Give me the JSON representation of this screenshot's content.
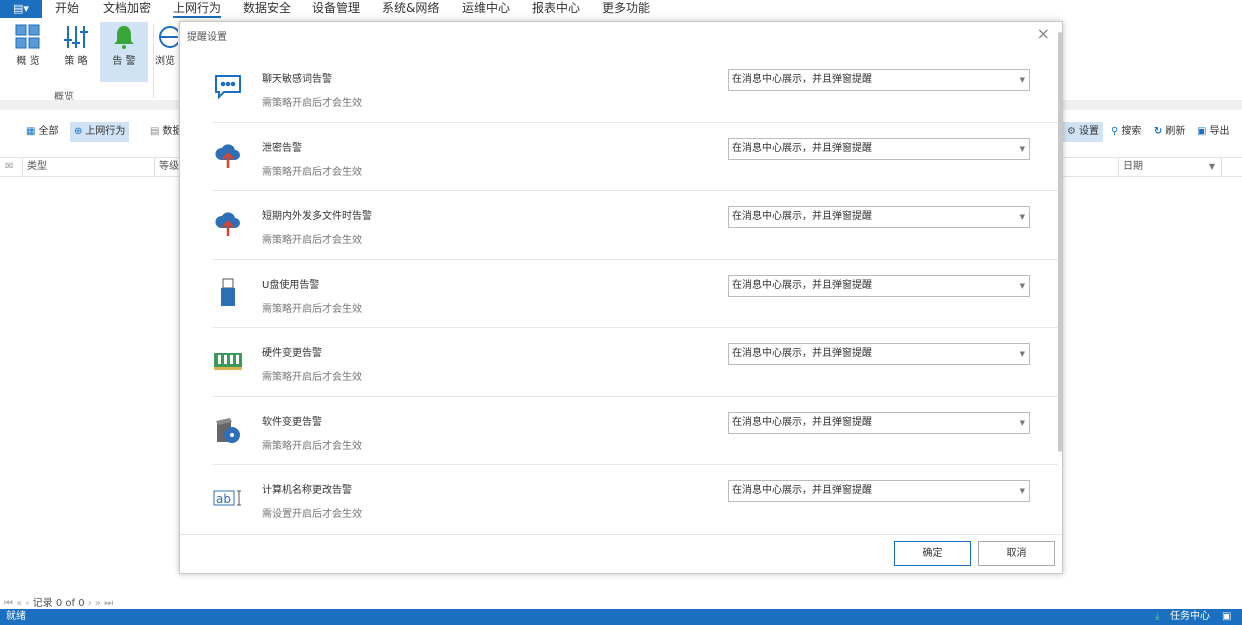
{
  "menu": {
    "app_icon": "app-menu-icon",
    "tabs": [
      "开始",
      "文档加密",
      "上网行为",
      "数据安全",
      "设备管理",
      "系统&网络",
      "运维中心",
      "报表中心",
      "更多功能"
    ],
    "active": "上网行为"
  },
  "ribbon": {
    "buttons": [
      {
        "label": "概 览",
        "icon": "grid-icon"
      },
      {
        "label": "策 略",
        "icon": "sliders-icon"
      },
      {
        "label": "告 警",
        "icon": "bell-icon"
      },
      {
        "label": "浏览",
        "icon": "globe-icon"
      }
    ],
    "group_label": "概览"
  },
  "toolbar": {
    "all": "全部",
    "web": "上网行为",
    "data": "数据",
    "settings": "设置",
    "search": "搜索",
    "refresh": "刷新",
    "export": "导出"
  },
  "table": {
    "columns": [
      "类型",
      "等级",
      "日期"
    ]
  },
  "pager": {
    "text": "记录 0 of 0"
  },
  "status": {
    "left": "就绪",
    "task_center": "任务中心"
  },
  "dialog": {
    "title": "提醒设置",
    "items": [
      {
        "title": "聊天敏感词告警",
        "desc": "需策略开启后才会生效",
        "value": "在消息中心展示，并且弹窗提醒",
        "icon": "chat-icon"
      },
      {
        "title": "泄密告警",
        "desc": "需策略开启后才会生效",
        "value": "在消息中心展示，并且弹窗提醒",
        "icon": "cloud-upload-icon"
      },
      {
        "title": "短期内外发多文件时告警",
        "desc": "需策略开启后才会生效",
        "value": "在消息中心展示，并且弹窗提醒",
        "icon": "cloud-upload-icon"
      },
      {
        "title": "U盘使用告警",
        "desc": "需策略开启后才会生效",
        "value": "在消息中心展示，并且弹窗提醒",
        "icon": "usb-icon"
      },
      {
        "title": "硬件变更告警",
        "desc": "需策略开启后才会生效",
        "value": "在消息中心展示，并且弹窗提醒",
        "icon": "memory-icon"
      },
      {
        "title": "软件变更告警",
        "desc": "需策略开启后才会生效",
        "value": "在消息中心展示，并且弹窗提醒",
        "icon": "software-disc-icon"
      },
      {
        "title": "计算机名称更改告警",
        "desc": "需设置开启后才会生效",
        "value": "在消息中心展示，并且弹窗提醒",
        "icon": "rename-icon"
      }
    ],
    "ok": "确定",
    "cancel": "取消"
  },
  "colors": {
    "accent": "#1a6fc0",
    "bell": "#3aa53a",
    "selected": "#cfe3f5"
  }
}
